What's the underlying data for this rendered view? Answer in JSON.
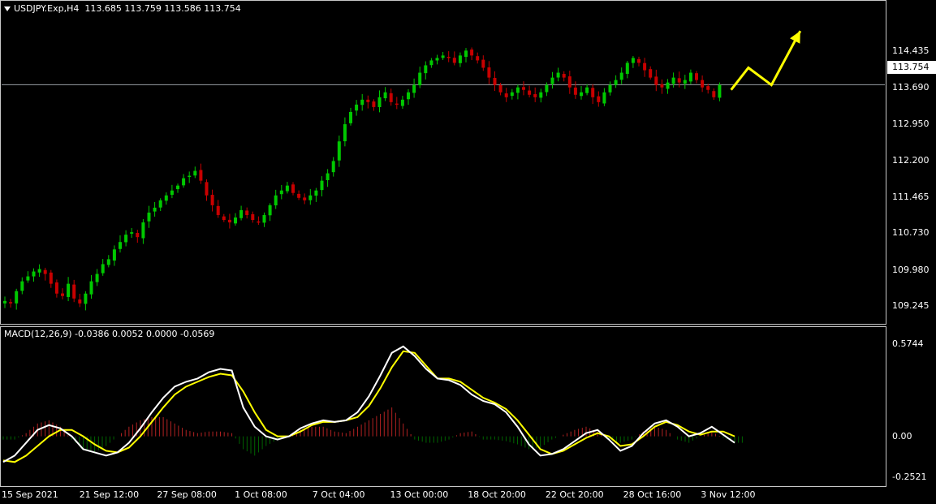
{
  "header": {
    "symbol": "USDJPY.Exp,H4",
    "ohlc": "113.685 113.759 113.586 113.754"
  },
  "indicator": {
    "label": "MACD(12,26,9) -0.0386 0.0052 0.0000 -0.0569"
  },
  "current_price": "113.754",
  "colors": {
    "background": "#000000",
    "bull_candle": "#00c800",
    "bear_candle": "#c80000",
    "macd_line": "#ffffff",
    "signal_line": "#ffff00",
    "hist_pos": "#b22222",
    "hist_neg": "#006400",
    "forecast_arrow": "#ffff00"
  },
  "chart_data": [
    {
      "type": "candlestick",
      "title": "USDJPY.Exp,H4",
      "ylim": [
        108.95,
        115.15
      ],
      "y_ticks": [
        "114.435",
        "113.690",
        "112.950",
        "112.200",
        "111.465",
        "110.730",
        "109.980",
        "109.245"
      ],
      "x_ticks": [
        "15 Sep 2021",
        "21 Sep 12:00",
        "27 Sep 08:00",
        "1 Oct 08:00",
        "7 Oct 04:00",
        "13 Oct 00:00",
        "18 Oct 20:00",
        "22 Oct 20:00",
        "28 Oct 16:00",
        "3 Nov 12:00"
      ],
      "horizontal_line": 113.754,
      "close_path": [
        109.35,
        109.3,
        109.55,
        109.75,
        109.85,
        109.95,
        110.0,
        109.9,
        109.7,
        109.5,
        109.45,
        109.7,
        109.4,
        109.3,
        109.5,
        109.75,
        109.9,
        110.1,
        110.2,
        110.4,
        110.55,
        110.7,
        110.75,
        110.65,
        110.95,
        111.15,
        111.25,
        111.4,
        111.5,
        111.6,
        111.7,
        111.85,
        111.9,
        112.0,
        111.8,
        111.5,
        111.3,
        111.1,
        111.0,
        110.95,
        111.05,
        111.2,
        111.1,
        111.0,
        110.95,
        111.1,
        111.3,
        111.5,
        111.6,
        111.7,
        111.55,
        111.45,
        111.4,
        111.5,
        111.6,
        111.8,
        111.95,
        112.2,
        112.6,
        112.95,
        113.2,
        113.35,
        113.45,
        113.4,
        113.3,
        113.5,
        113.6,
        113.4,
        113.35,
        113.45,
        113.6,
        113.75,
        114.0,
        114.15,
        114.25,
        114.3,
        114.35,
        114.3,
        114.2,
        114.35,
        114.45,
        114.35,
        114.25,
        114.1,
        113.9,
        113.75,
        113.6,
        113.5,
        113.6,
        113.7,
        113.65,
        113.55,
        113.5,
        113.6,
        113.75,
        113.9,
        114.0,
        113.9,
        113.7,
        113.55,
        113.6,
        113.7,
        113.5,
        113.4,
        113.6,
        113.75,
        113.85,
        114.0,
        114.2,
        114.3,
        114.2,
        114.05,
        113.9,
        113.75,
        113.7,
        113.8,
        113.9,
        113.8,
        113.85,
        114.0,
        113.85,
        113.7,
        113.65,
        113.5,
        113.75
      ],
      "forecast_arrow_path": [
        [
          126,
          113.65
        ],
        [
          129,
          114.1
        ],
        [
          133,
          113.75
        ],
        [
          138,
          114.85
        ]
      ]
    },
    {
      "type": "line",
      "title": "MACD(12,26,9)",
      "ylim": [
        -0.29,
        0.62
      ],
      "y_ticks": [
        "0.5744",
        "0.00",
        "-0.2521"
      ],
      "series": [
        {
          "name": "MACD",
          "values": [
            -0.16,
            -0.12,
            -0.04,
            0.04,
            0.07,
            0.05,
            0.0,
            -0.08,
            -0.1,
            -0.12,
            -0.1,
            -0.04,
            0.05,
            0.15,
            0.24,
            0.31,
            0.34,
            0.36,
            0.4,
            0.42,
            0.41,
            0.18,
            0.06,
            0.0,
            -0.02,
            0.0,
            0.05,
            0.08,
            0.1,
            0.09,
            0.1,
            0.15,
            0.25,
            0.38,
            0.52,
            0.56,
            0.5,
            0.42,
            0.36,
            0.35,
            0.32,
            0.26,
            0.22,
            0.2,
            0.15,
            0.06,
            -0.05,
            -0.12,
            -0.11,
            -0.08,
            -0.03,
            0.02,
            0.04,
            -0.02,
            -0.09,
            -0.06,
            0.02,
            0.08,
            0.1,
            0.06,
            0.0,
            0.02,
            0.06,
            0.01,
            -0.04
          ]
        },
        {
          "name": "Signal",
          "values": [
            -0.15,
            -0.16,
            -0.12,
            -0.06,
            0.0,
            0.04,
            0.04,
            0.0,
            -0.05,
            -0.09,
            -0.1,
            -0.07,
            0.0,
            0.09,
            0.18,
            0.26,
            0.31,
            0.34,
            0.37,
            0.39,
            0.38,
            0.28,
            0.15,
            0.04,
            0.0,
            0.0,
            0.03,
            0.07,
            0.09,
            0.09,
            0.1,
            0.12,
            0.19,
            0.3,
            0.43,
            0.53,
            0.52,
            0.44,
            0.36,
            0.36,
            0.34,
            0.29,
            0.24,
            0.21,
            0.17,
            0.1,
            0.01,
            -0.08,
            -0.11,
            -0.09,
            -0.05,
            -0.01,
            0.02,
            0.0,
            -0.06,
            -0.05,
            0.0,
            0.06,
            0.09,
            0.07,
            0.03,
            0.01,
            0.03,
            0.03,
            0.0
          ]
        },
        {
          "name": "Histogram",
          "values": [
            -0.02,
            -0.02,
            0.02,
            0.08,
            0.1,
            0.06,
            -0.02,
            -0.08,
            -0.1,
            -0.06,
            0.0,
            0.06,
            0.1,
            0.12,
            0.12,
            0.08,
            0.04,
            0.02,
            0.03,
            0.03,
            0.02,
            -0.08,
            -0.12,
            -0.06,
            -0.02,
            0.0,
            0.04,
            0.06,
            0.06,
            0.03,
            0.02,
            0.06,
            0.1,
            0.14,
            0.18,
            0.08,
            -0.02,
            -0.04,
            -0.04,
            -0.02,
            0.02,
            0.03,
            -0.02,
            -0.02,
            -0.03,
            -0.05,
            -0.08,
            -0.07,
            -0.02,
            0.01,
            0.04,
            0.06,
            0.03,
            -0.02,
            -0.04,
            -0.02,
            0.03,
            0.06,
            0.04,
            -0.02,
            -0.04,
            0.0,
            0.03,
            -0.01,
            -0.04
          ]
        }
      ]
    }
  ]
}
